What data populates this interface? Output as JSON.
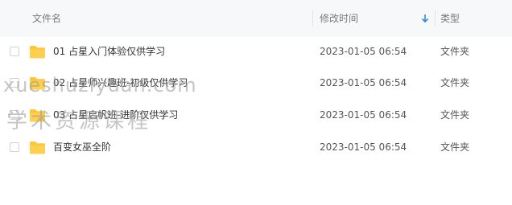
{
  "header": {
    "name_label": "文件名",
    "time_label": "修改时间",
    "type_label": "类型",
    "sort_icon": "sort-down-arrow-icon"
  },
  "rows": [
    {
      "name": "01 占星入门体验仅供学习",
      "modified": "2023-01-05 06:54",
      "type": "文件夹"
    },
    {
      "name": "02 占星师兴趣班-初级仅供学习",
      "modified": "2023-01-05 06:54",
      "type": "文件夹"
    },
    {
      "name": "03 占星启帆班-进阶仅供学习",
      "modified": "2023-01-05 06:54",
      "type": "文件夹"
    },
    {
      "name": "百变女巫全阶",
      "modified": "2023-01-05 06:54",
      "type": "文件夹"
    }
  ],
  "watermark": {
    "line1": "xueshuziyuan.com",
    "line2": "学术资源课程"
  },
  "colors": {
    "header_bg": "#f7f8fa",
    "folder": "#ffc63b",
    "accent": "#2b8ae8"
  }
}
